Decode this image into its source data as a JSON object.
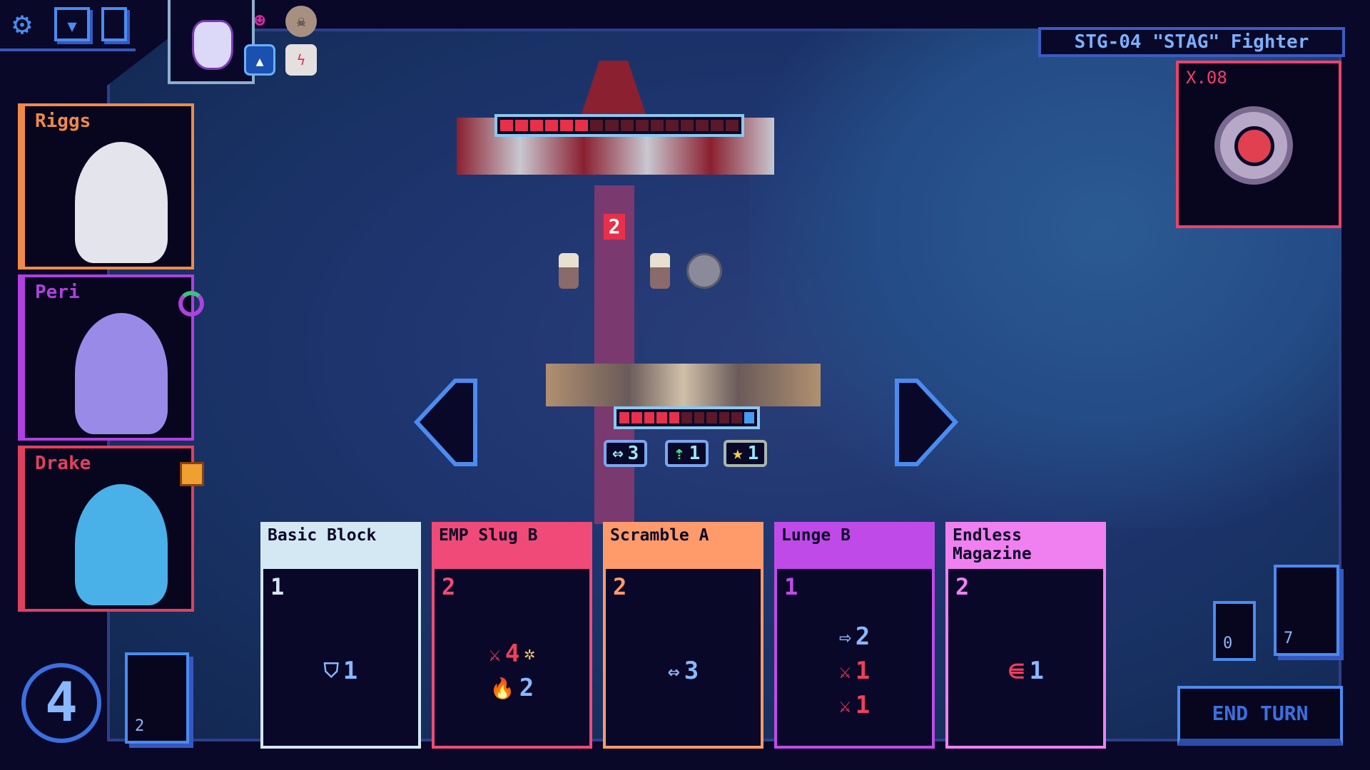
{
  "toolbar": {
    "icons": [
      "gear-icon",
      "map-icon",
      "deck-icon"
    ]
  },
  "status_icons": [
    "cat-portrait",
    "demon-mask-icon",
    "shield-up-icon",
    "skull-badge-icon",
    "timer-icon"
  ],
  "crew": [
    {
      "name": "Riggs",
      "color": "#f08a48"
    },
    {
      "name": "Peri",
      "color": "#b040e0"
    },
    {
      "name": "Drake",
      "color": "#e04060"
    }
  ],
  "enemy": {
    "name": "STG-04 \"STAG\" Fighter",
    "pilot_code": "X.08",
    "hull_segments": 16,
    "hull_filled": 6,
    "shield_segments": 5,
    "incoming_damage": "2"
  },
  "player": {
    "hull_segments": 10,
    "hull_filled": 5,
    "shield_segments": 2,
    "statuses": [
      {
        "icon": "evade-icon",
        "value": "3"
      },
      {
        "icon": "droneshift-icon",
        "value": "1"
      },
      {
        "icon": "star-icon",
        "value": "1"
      }
    ]
  },
  "hand": [
    {
      "name": "Basic Block",
      "cost": "1",
      "color": "#d4e8f4",
      "effects": [
        {
          "icon": "shield-icon",
          "value": "1"
        }
      ]
    },
    {
      "name": "EMP Slug B",
      "cost": "2",
      "color": "#f04a78",
      "effects": [
        {
          "icon": "attack-icon",
          "value": "4",
          "extra": "stun-icon"
        },
        {
          "icon": "heat-icon",
          "value": "2"
        }
      ]
    },
    {
      "name": "Scramble A",
      "cost": "2",
      "color": "#ff9a6a",
      "effects": [
        {
          "icon": "evade-icon",
          "value": "3"
        }
      ]
    },
    {
      "name": "Lunge B",
      "cost": "1",
      "color": "#c04ae8",
      "effects": [
        {
          "icon": "move-right-icon",
          "value": "2"
        },
        {
          "icon": "attack-icon",
          "value": "1"
        },
        {
          "icon": "attack-icon",
          "value": "1"
        }
      ]
    },
    {
      "name": "Endless Magazine",
      "cost": "2",
      "color": "#f080f0",
      "effects": [
        {
          "icon": "ammo-icon",
          "value": "1"
        }
      ]
    }
  ],
  "energy": "4",
  "draw_pile": "2",
  "discard_pile": "0",
  "exhaust_pile": "7",
  "end_turn_label": "END TURN"
}
